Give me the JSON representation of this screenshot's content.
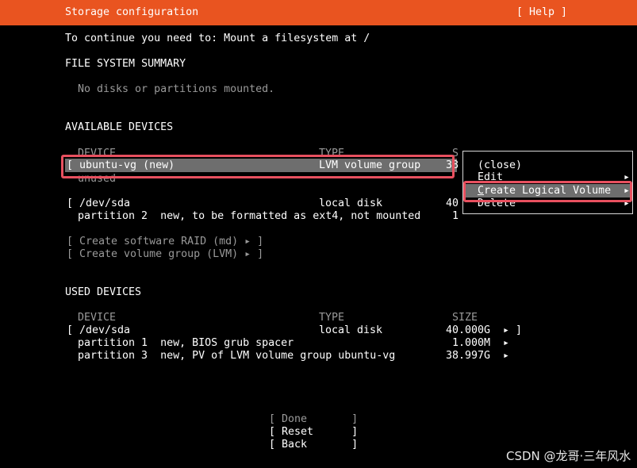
{
  "header": {
    "title": "Storage configuration",
    "help": "[ Help ]"
  },
  "intro": "To continue you need to: Mount a filesystem at /",
  "summary": {
    "title": "FILE SYSTEM SUMMARY",
    "empty": "No disks or partitions mounted."
  },
  "available": {
    "title": "AVAILABLE DEVICES",
    "col_device": "DEVICE",
    "col_type": "TYPE",
    "col_size": "S",
    "vg_name": "[ ubuntu-vg (new)",
    "vg_type": "LVM volume group",
    "vg_size": "38",
    "vg_sub": "unused",
    "sda_name": "[ /dev/sda",
    "sda_type": "local disk",
    "sda_size": "40",
    "p2": "partition 2  new, to be formatted as ext4, not mounted",
    "p2_size": "1",
    "raid": "[ Create software RAID (md) ▸ ]",
    "lvm": "[ Create volume group (LVM) ▸ ]"
  },
  "menu": {
    "arrow": "◂",
    "close": "(close)",
    "edit": "Edit",
    "create_first": "C",
    "create_rest": "reate Logical Volume",
    "delete": "Delete",
    "sub_arrow": "▸"
  },
  "used": {
    "title": "USED DEVICES",
    "col_device": "DEVICE",
    "col_type": "TYPE",
    "col_size": "SIZE",
    "sda_name": "[ /dev/sda",
    "sda_type": "local disk",
    "sda_size": "40.000G",
    "sda_action": "▸ ]",
    "p1": "partition 1  new, BIOS grub spacer",
    "p1_size": "1.000M",
    "p3": "partition 3  new, PV of LVM volume group ubuntu-vg",
    "p3_size": "38.997G",
    "arrow": "▸"
  },
  "buttons": {
    "done": "[ Done       ]",
    "reset": "[ Reset      ]",
    "back": "[ Back       ]"
  },
  "watermark": "CSDN @龙哥·三年风水",
  "colors": {
    "header_bg": "#e95420",
    "highlight": "#6e6e6e",
    "annotation": "#e8505f"
  }
}
